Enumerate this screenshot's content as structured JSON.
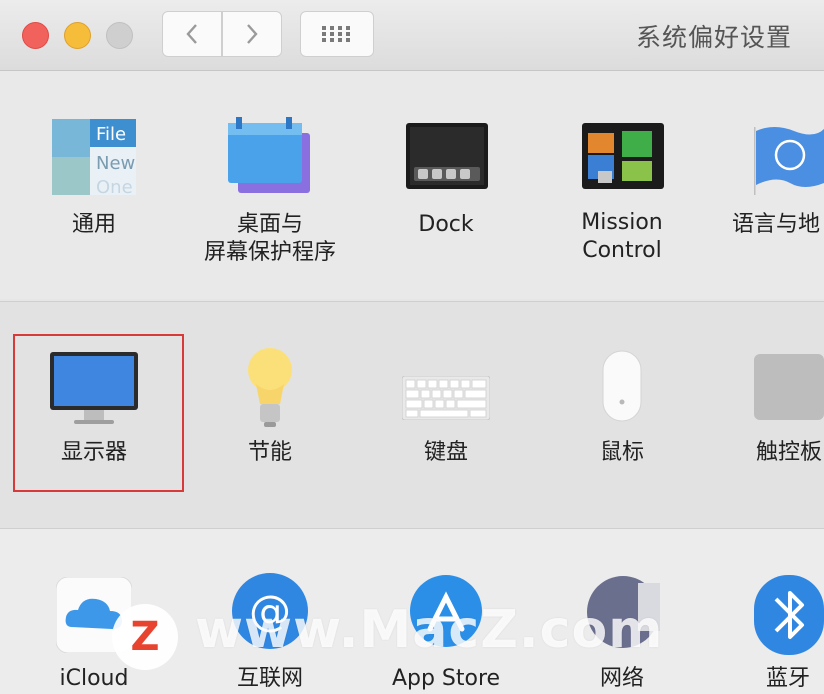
{
  "window": {
    "title": "系统偏好设置"
  },
  "toolbar": {
    "back_icon": "chevron-left-icon",
    "forward_icon": "chevron-right-icon",
    "grid_icon": "grid-icon"
  },
  "panes_row1": [
    {
      "label": "通用",
      "icon": "general-icon"
    },
    {
      "label": "桌面与\n屏幕保护程序",
      "icon": "desktop-icon"
    },
    {
      "label": "Dock",
      "icon": "dock-icon"
    },
    {
      "label": "Mission\nControl",
      "icon": "mission-control-icon"
    },
    {
      "label": "语言与地",
      "icon": "language-icon"
    }
  ],
  "panes_row2": [
    {
      "label": "显示器",
      "icon": "display-icon",
      "selected": true
    },
    {
      "label": "节能",
      "icon": "bulb-icon"
    },
    {
      "label": "键盘",
      "icon": "keyboard-icon"
    },
    {
      "label": "鼠标",
      "icon": "mouse-icon"
    },
    {
      "label": "触控板",
      "icon": "trackpad-icon"
    }
  ],
  "panes_row3": [
    {
      "label": "iCloud",
      "icon": "icloud-icon"
    },
    {
      "label": "互联网",
      "icon": "internet-icon"
    },
    {
      "label": "App Store",
      "icon": "appstore-icon"
    },
    {
      "label": "网络",
      "icon": "network-icon"
    },
    {
      "label": "蓝牙",
      "icon": "bluetooth-icon"
    }
  ],
  "general_icon_text": [
    "File",
    "New",
    "One"
  ],
  "watermark": {
    "logo_letter": "Z",
    "text": "www.MacZ.com"
  },
  "colors": {
    "selection": "#d83a3a",
    "close": "#f2625c",
    "minimize": "#f5bd3a"
  }
}
